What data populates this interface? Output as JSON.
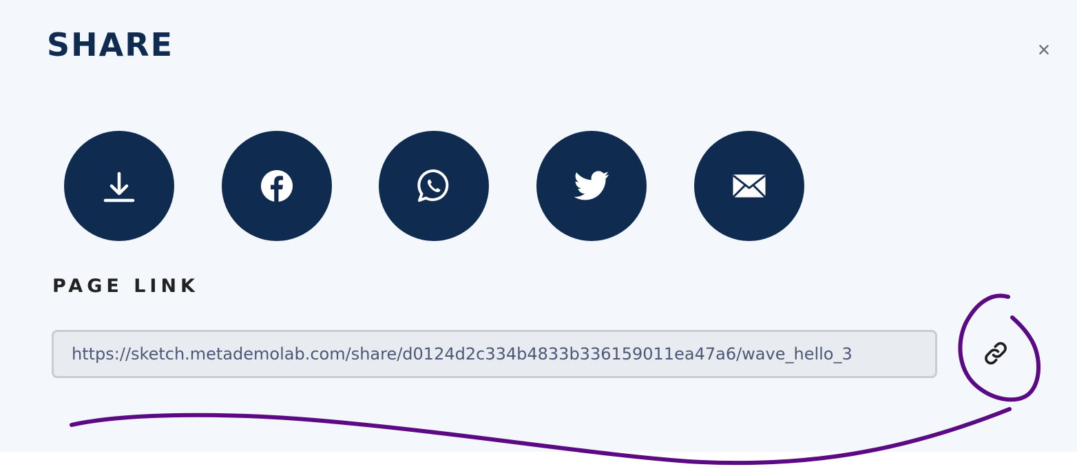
{
  "dialog": {
    "title": "SHARE",
    "close_label": "×"
  },
  "share_buttons": [
    {
      "name": "download",
      "icon": "download-icon"
    },
    {
      "name": "facebook",
      "icon": "facebook-icon"
    },
    {
      "name": "whatsapp",
      "icon": "whatsapp-icon"
    },
    {
      "name": "twitter",
      "icon": "twitter-icon"
    },
    {
      "name": "email",
      "icon": "email-icon"
    }
  ],
  "page_link": {
    "label": "PAGE LINK",
    "url": "https://sketch.metademolab.com/share/d0124d2c334b4833b336159011ea47a6/wave_hello_3",
    "copy_icon": "link-icon"
  },
  "colors": {
    "primary": "#0f2b4f",
    "panel_background": "#f4f7fb",
    "annotation": "#5b0a83"
  }
}
